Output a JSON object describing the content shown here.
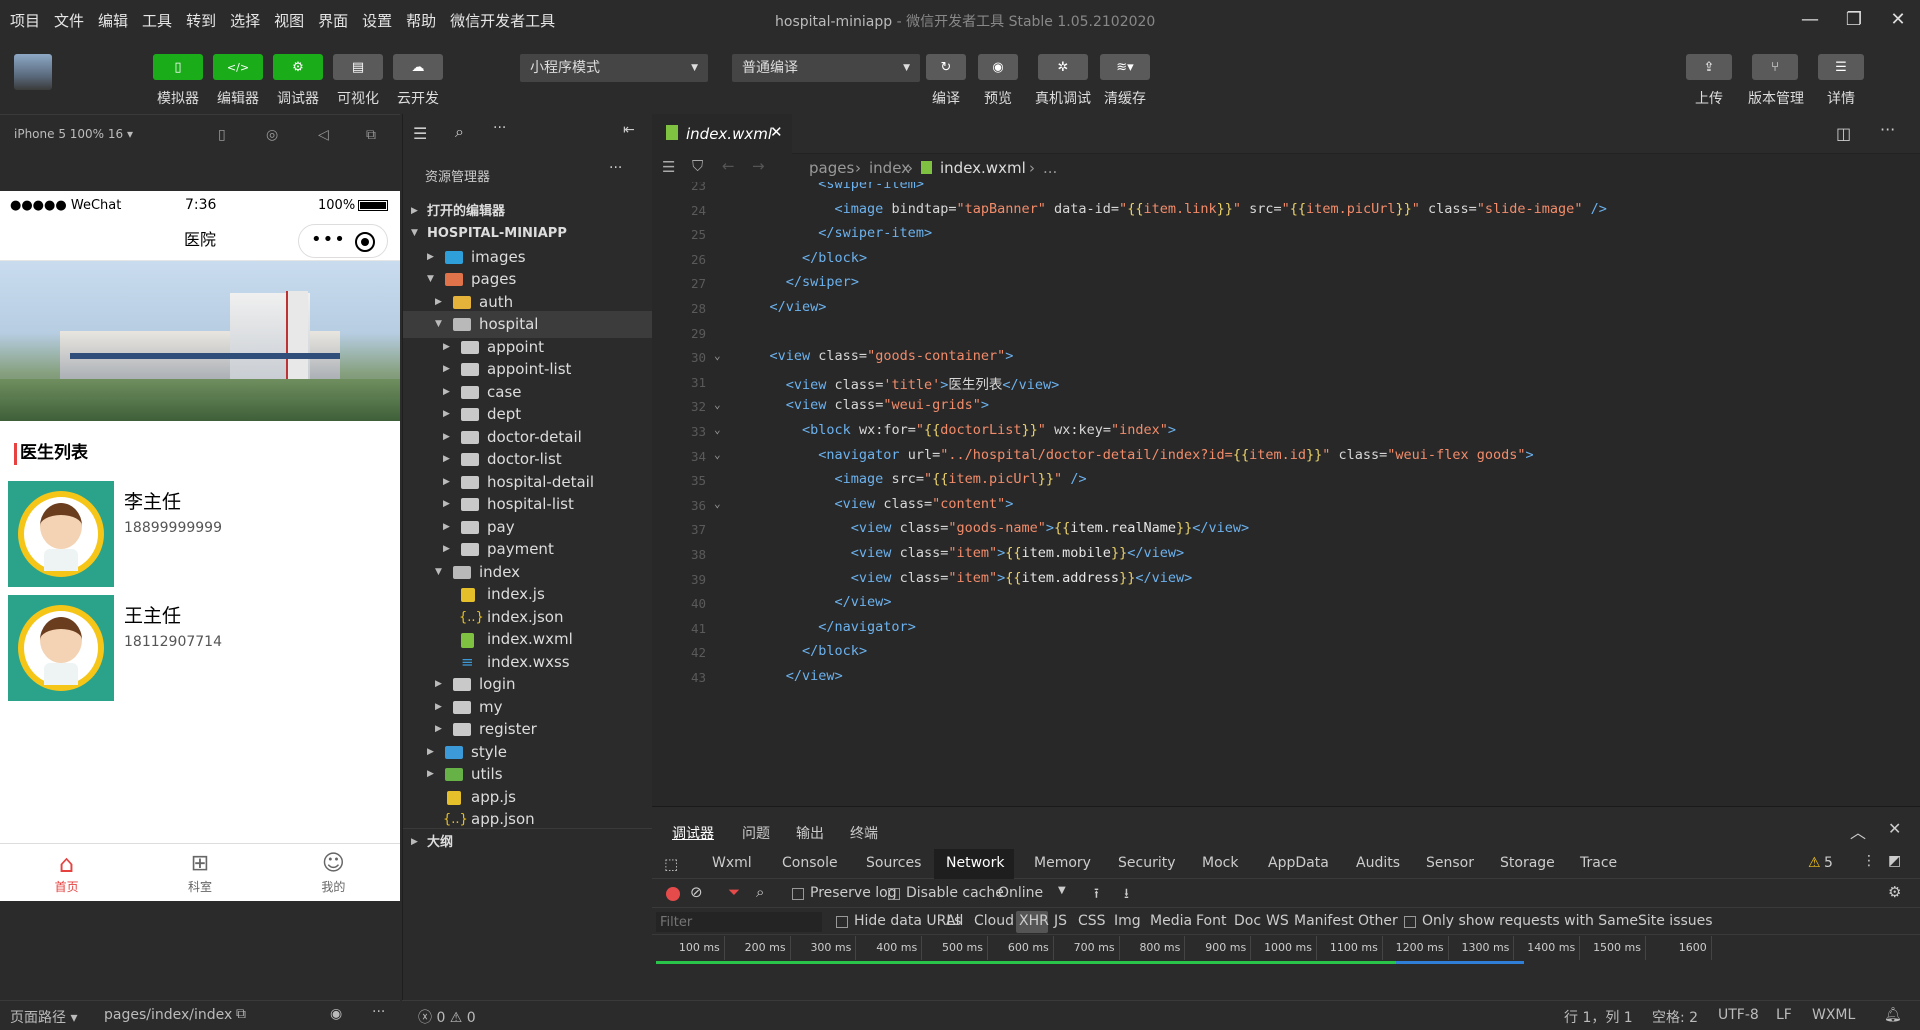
{
  "menus": [
    "项目",
    "文件",
    "编辑",
    "工具",
    "转到",
    "选择",
    "视图",
    "界面",
    "设置",
    "帮助",
    "微信开发者工具"
  ],
  "window_title": "hospital-miniapp",
  "window_subtitle": " - 微信开发者工具 Stable 1.05.2102020",
  "toolbar": {
    "simulator": "模拟器",
    "editor": "编辑器",
    "debugger": "调试器",
    "visual": "可视化",
    "cloud": "云开发",
    "mode_select": "小程序模式",
    "compile_select": "普通编译",
    "compile": "编译",
    "preview": "预览",
    "remote_debug": "真机调试",
    "clear_cache": "清缓存",
    "upload": "上传",
    "version": "版本管理",
    "details": "详情"
  },
  "sim": {
    "device": "iPhone 5 100% 16 ▾",
    "carrier": "●●●●● WeChat",
    "time": "7:36",
    "battery": "100%",
    "nav_title": "医院",
    "section_title": "医生列表",
    "doctors": [
      {
        "name": "李主任",
        "mobile": "18899999999"
      },
      {
        "name": "王主任",
        "mobile": "18112907714"
      }
    ],
    "tabs": [
      "首页",
      "科室",
      "我的"
    ],
    "path_label": "页面路径 ▾",
    "path_value": "pages/index/index"
  },
  "explorer": {
    "title": "资源管理器",
    "open_editors": "打开的编辑器",
    "project": "HOSPITAL-MINIAPP",
    "items": [
      "images",
      "pages",
      "auth",
      "hospital",
      "appoint",
      "appoint-list",
      "case",
      "dept",
      "doctor-detail",
      "doctor-list",
      "hospital-detail",
      "hospital-list",
      "pay",
      "payment",
      "index",
      "index.js",
      "index.json",
      "index.wxml",
      "index.wxss",
      "login",
      "my",
      "register",
      "style",
      "utils",
      "app.js",
      "app.json"
    ],
    "outline": "大纲"
  },
  "editor": {
    "tab": "index.wxml",
    "crumb": [
      "pages",
      "index",
      "index.wxml",
      "..."
    ]
  },
  "code_lines": [
    {
      "n": "23",
      "code": "          <swiper-item>"
    },
    {
      "n": "24",
      "code": "            <image bindtap=\"tapBanner\" data-id=\"{{item.link}}\" src=\"{{item.picUrl}}\" class=\"slide-image\" />"
    },
    {
      "n": "25",
      "code": "          </swiper-item>"
    },
    {
      "n": "26",
      "code": "        </block>"
    },
    {
      "n": "27",
      "code": "      </swiper>"
    },
    {
      "n": "28",
      "code": "    </view>"
    },
    {
      "n": "29",
      "code": ""
    },
    {
      "n": "30",
      "code": "    <view class=\"goods-container\">"
    },
    {
      "n": "31",
      "code": "      <view class='title'>医生列表</view>"
    },
    {
      "n": "32",
      "code": "      <view class=\"weui-grids\">"
    },
    {
      "n": "33",
      "code": "        <block wx:for=\"{{doctorList}}\" wx:key=\"index\">"
    },
    {
      "n": "34",
      "code": "          <navigator url=\"../hospital/doctor-detail/index?id={{item.id}}\" class=\"weui-flex goods\">"
    },
    {
      "n": "35",
      "code": "            <image src=\"{{item.picUrl}}\" />"
    },
    {
      "n": "36",
      "code": "            <view class=\"content\">"
    },
    {
      "n": "37",
      "code": "              <view class=\"goods-name\">{{item.realName}}</view>"
    },
    {
      "n": "38",
      "code": "              <view class=\"item\">{{item.mobile}}</view>"
    },
    {
      "n": "39",
      "code": "              <view class=\"item\">{{item.address}}</view>"
    },
    {
      "n": "40",
      "code": "            </view>"
    },
    {
      "n": "41",
      "code": "          </navigator>"
    },
    {
      "n": "42",
      "code": "        </block>"
    },
    {
      "n": "43",
      "code": "      </view>"
    }
  ],
  "devtools": {
    "panel_tabs": [
      "调试器",
      "问题",
      "输出",
      "终端"
    ],
    "tabs": [
      "Wxml",
      "Console",
      "Sources",
      "Network",
      "Memory",
      "Security",
      "Mock",
      "AppData",
      "Audits",
      "Sensor",
      "Storage",
      "Trace"
    ],
    "active_tab": "Network",
    "warnings": "5",
    "preserve_log": "Preserve log",
    "disable_cache": "Disable cache",
    "throttle": "Online",
    "filter_placeholder": "Filter",
    "hide_data_urls": "Hide data URLs",
    "types": [
      "All",
      "Cloud",
      "XHR",
      "JS",
      "CSS",
      "Img",
      "Media",
      "Font",
      "Doc",
      "WS",
      "Manifest",
      "Other"
    ],
    "samesite": "Only show requests with SameSite issues",
    "timeline": [
      "100 ms",
      "200 ms",
      "300 ms",
      "400 ms",
      "500 ms",
      "600 ms",
      "700 ms",
      "800 ms",
      "900 ms",
      "1000 ms",
      "1100 ms",
      "1200 ms",
      "1300 ms",
      "1400 ms",
      "1500 ms",
      "1600"
    ]
  },
  "statusbar": {
    "problems": "ⓧ 0 ⚠ 0",
    "position": "行 1，列 1",
    "spaces": "空格: 2",
    "encoding": "UTF-8",
    "eol": "LF",
    "lang": "WXML"
  }
}
